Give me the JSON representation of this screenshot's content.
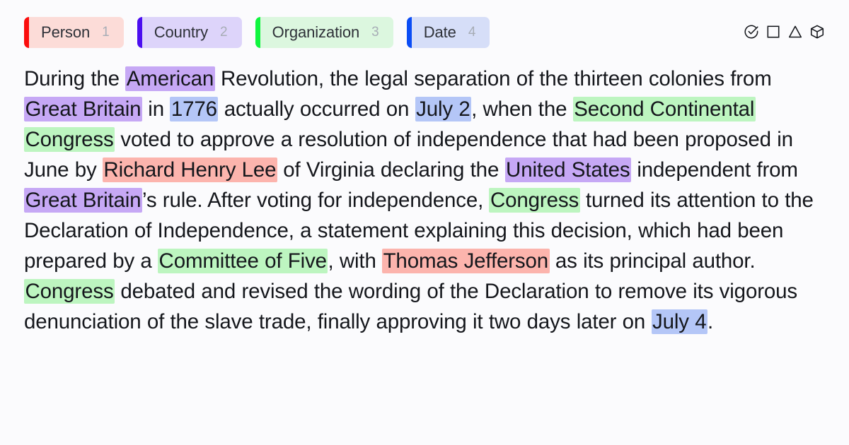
{
  "legend": {
    "chips": [
      {
        "label": "Person",
        "count": "1",
        "bar": "#fb0d0d",
        "bg": "#fcdcd8"
      },
      {
        "label": "Country",
        "count": "2",
        "bar": "#4b0ef0",
        "bg": "#ddd4fa"
      },
      {
        "label": "Organization",
        "count": "3",
        "bar": "#10f63f",
        "bg": "#dcf7df"
      },
      {
        "label": "Date",
        "count": "4",
        "bar": "#0b4df5",
        "bg": "#d6def8"
      }
    ],
    "icons": [
      {
        "name": "check-circle-icon"
      },
      {
        "name": "square-icon"
      },
      {
        "name": "triangle-icon"
      },
      {
        "name": "cube-icon"
      }
    ]
  },
  "colors": {
    "person_highlight": "#fcb4ad",
    "country_highlight": "#c6a8f5",
    "organization_highlight": "#bdf5c0",
    "date_highlight": "#b4c6f7",
    "page_background": "#fbfbfd",
    "text": "#15171c"
  },
  "document": {
    "tokens": [
      {
        "text": "During the "
      },
      {
        "text": "American",
        "entity": "Country"
      },
      {
        "text": " Revolution, the legal separation of the thirteen colonies from "
      },
      {
        "text": "Great Britain",
        "entity": "Country"
      },
      {
        "text": " in "
      },
      {
        "text": "1776",
        "entity": "Date"
      },
      {
        "text": " actually occurred on "
      },
      {
        "text": "July 2",
        "entity": "Date"
      },
      {
        "text": ", when the "
      },
      {
        "text": "Second Continental Congress",
        "entity": "Organization"
      },
      {
        "text": " voted to approve a resolution of independence that had been proposed in June by "
      },
      {
        "text": "Richard Henry Lee",
        "entity": "Person"
      },
      {
        "text": " of Virginia declaring the "
      },
      {
        "text": "United States",
        "entity": "Country"
      },
      {
        "text": " independent from "
      },
      {
        "text": "Great Britain",
        "entity": "Country"
      },
      {
        "text": "’s rule. After voting for independence, "
      },
      {
        "text": "Congress",
        "entity": "Organization"
      },
      {
        "text": " turned its attention to the Declaration of Independence, a statement explaining this decision, which had been prepared by a "
      },
      {
        "text": "Committee of Five",
        "entity": "Organization"
      },
      {
        "text": ", with "
      },
      {
        "text": "Thomas Jefferson",
        "entity": "Person"
      },
      {
        "text": " as its principal author. "
      },
      {
        "text": "Congress",
        "entity": "Organization"
      },
      {
        "text": " debated and revised the wording of the Declaration to remove its vigorous denunciation of the slave trade, finally approving it two days later on "
      },
      {
        "text": "July 4",
        "entity": "Date"
      },
      {
        "text": "."
      }
    ]
  }
}
